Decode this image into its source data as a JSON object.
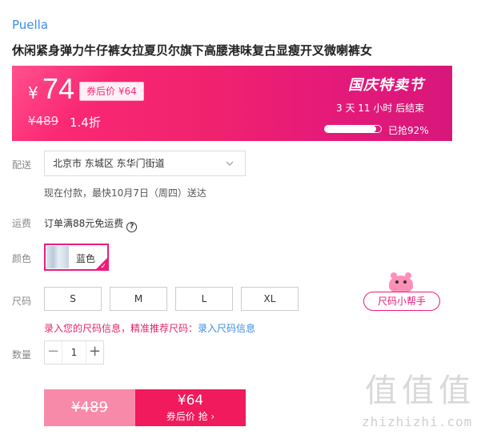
{
  "product": {
    "brand": "Puella",
    "title": "休闲紧身弹力牛仔裤女拉夏贝尔旗下高腰港味复古显瘦开叉微喇裤女"
  },
  "promo": {
    "currency": "¥",
    "price": "74",
    "coupon_tag": "券后价 ¥64",
    "original_price": "¥489",
    "discount": "1.4折",
    "event_name": "国庆特卖节",
    "countdown": "3 天 11 小时 后结束",
    "sold_text": "已抢92%",
    "sold_fraction": 0.92
  },
  "delivery": {
    "label": "配送",
    "address": "北京市 东城区 东华门街道",
    "note": "现在付款，最快10月7日（周四）送达"
  },
  "freight": {
    "label": "运费",
    "text": "订单满88元免运费",
    "help_icon": "question-circle-icon"
  },
  "color": {
    "label": "颜色",
    "options": [
      {
        "name": "蓝色",
        "selected": true
      }
    ]
  },
  "size": {
    "label": "尺码",
    "options": [
      "S",
      "M",
      "L",
      "XL"
    ],
    "helper_button": "尺码小帮手",
    "hint_prefix": "录入您的尺码信息，精准推荐尺码：",
    "hint_link": "录入尺码信息"
  },
  "quantity": {
    "label": "数量",
    "value": "1",
    "minus": "−",
    "plus": "+"
  },
  "buy": {
    "original_price": "¥489",
    "coupon_price": "¥64",
    "coupon_label": "券后价 抢 ›"
  },
  "watermark": {
    "big": "值值值",
    "small": "zhizhizhi.com"
  },
  "colors": {
    "accent": "#f01a79",
    "link": "#3a8ee6",
    "banner": "#ff2a75"
  }
}
